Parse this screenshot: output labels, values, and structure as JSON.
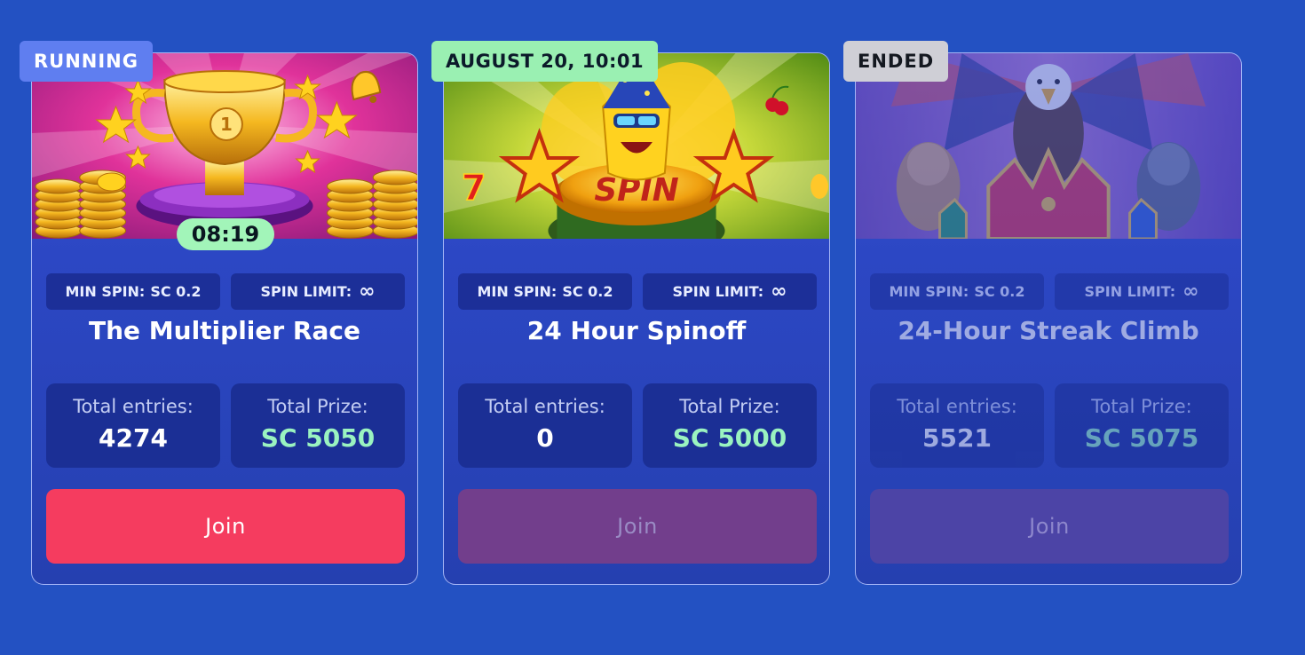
{
  "cards": [
    {
      "status": "RUNNING",
      "timer": "08:19",
      "min_spin_label": "MIN SPIN:",
      "min_spin_value": "SC 0.2",
      "spin_limit_label": "SPIN LIMIT:",
      "spin_limit_value": "∞",
      "title": "The Multiplier Race",
      "entries_label": "Total entries:",
      "entries_value": "4274",
      "prize_label": "Total Prize:",
      "prize_value": "SC 5050",
      "join_label": "Join",
      "join_enabled": true
    },
    {
      "status": "AUGUST 20, 10:01",
      "min_spin_label": "MIN SPIN:",
      "min_spin_value": "SC 0.2",
      "spin_limit_label": "SPIN LIMIT:",
      "spin_limit_value": "∞",
      "title": "24 Hour Spinoff",
      "banner_text": "SPIN",
      "entries_label": "Total entries:",
      "entries_value": "0",
      "prize_label": "Total Prize:",
      "prize_value": "SC 5000",
      "join_label": "Join",
      "join_enabled": false
    },
    {
      "status": "ENDED",
      "min_spin_label": "MIN SPIN:",
      "min_spin_value": "SC 0.2",
      "spin_limit_label": "SPIN LIMIT:",
      "spin_limit_value": "∞",
      "title": "24-Hour Streak Climb",
      "entries_label": "Total entries:",
      "entries_value": "5521",
      "prize_label": "Total Prize:",
      "prize_value": "SC 5075",
      "join_label": "Join",
      "join_enabled": false
    }
  ],
  "colors": {
    "background": "#2351c2",
    "running_badge": "#5f7ef0",
    "upcoming_badge": "#9af0b2",
    "ended_badge": "#cfcfd6",
    "join_active": "#f53c5f",
    "prize_value": "#9af3c0"
  }
}
